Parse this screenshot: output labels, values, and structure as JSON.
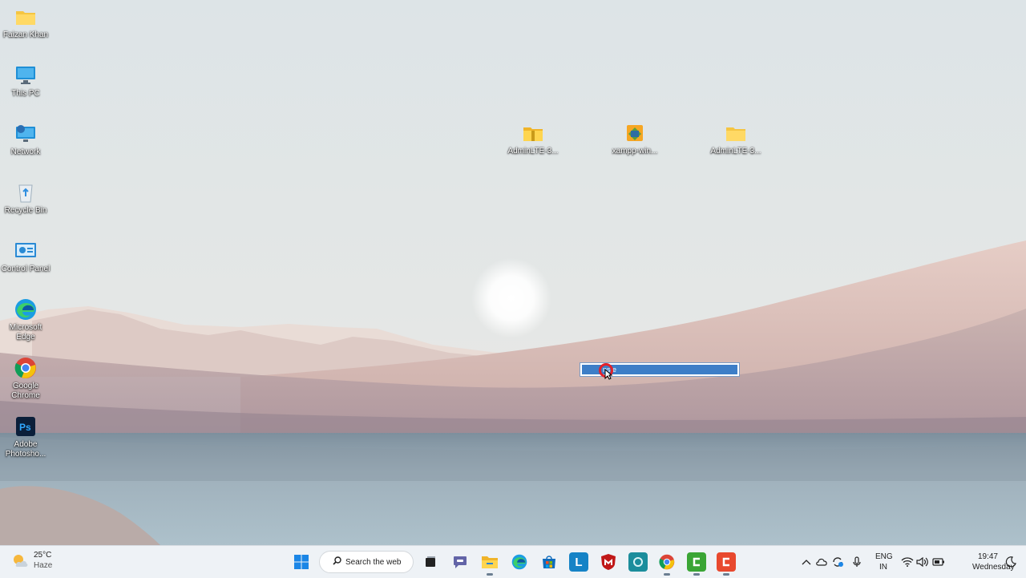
{
  "desktop": {
    "left_icons": [
      {
        "label": "Faizan Khan",
        "icon": "folder-icon"
      },
      {
        "label": "This PC",
        "icon": "monitor-icon"
      },
      {
        "label": "Network",
        "icon": "network-icon"
      },
      {
        "label": "Recycle Bin",
        "icon": "recycle-bin-icon"
      },
      {
        "label": "Control Panel",
        "icon": "control-panel-icon"
      },
      {
        "label": "Microsoft Edge",
        "icon": "edge-icon"
      },
      {
        "label": "Google Chrome",
        "icon": "chrome-icon"
      },
      {
        "label": "Adobe Photosho...",
        "icon": "photoshop-icon"
      }
    ],
    "center_icons": [
      {
        "label": "AdminLTE-3...",
        "icon": "zip-folder-icon"
      },
      {
        "label": "xampp-win...",
        "icon": "xampp-installer-icon"
      },
      {
        "label": "AdminLTE-3...",
        "icon": "folder-icon"
      }
    ],
    "rename_box": {
      "value": "ns e"
    }
  },
  "taskbar": {
    "weather": {
      "temp": "25°C",
      "condition": "Haze"
    },
    "search": {
      "label": "Search the web"
    },
    "apps": [
      {
        "name": "start",
        "icon": "windows-start-icon"
      },
      {
        "name": "task-view",
        "icon": "task-view-icon"
      },
      {
        "name": "teams",
        "icon": "teams-chat-icon"
      },
      {
        "name": "file-explorer",
        "icon": "file-explorer-icon"
      },
      {
        "name": "edge",
        "icon": "edge-icon"
      },
      {
        "name": "store",
        "icon": "store-icon"
      },
      {
        "name": "l-app",
        "icon": "l-app-icon",
        "glyph": "L"
      },
      {
        "name": "mcafee",
        "icon": "mcafee-icon"
      },
      {
        "name": "teal-app",
        "icon": "teal-app-icon"
      },
      {
        "name": "chrome",
        "icon": "chrome-icon"
      },
      {
        "name": "camtasia-green",
        "icon": "camtasia-green-icon"
      },
      {
        "name": "camtasia-orange",
        "icon": "camtasia-orange-icon"
      }
    ],
    "tray": {
      "lang_top": "ENG",
      "lang_bottom": "IN",
      "time": "19:47",
      "date": "Wednesday"
    }
  },
  "colors": {
    "selection": "#3d7ec7",
    "taskbar_bg": "#eef2f6",
    "cursor_ring": "#e3212a"
  }
}
